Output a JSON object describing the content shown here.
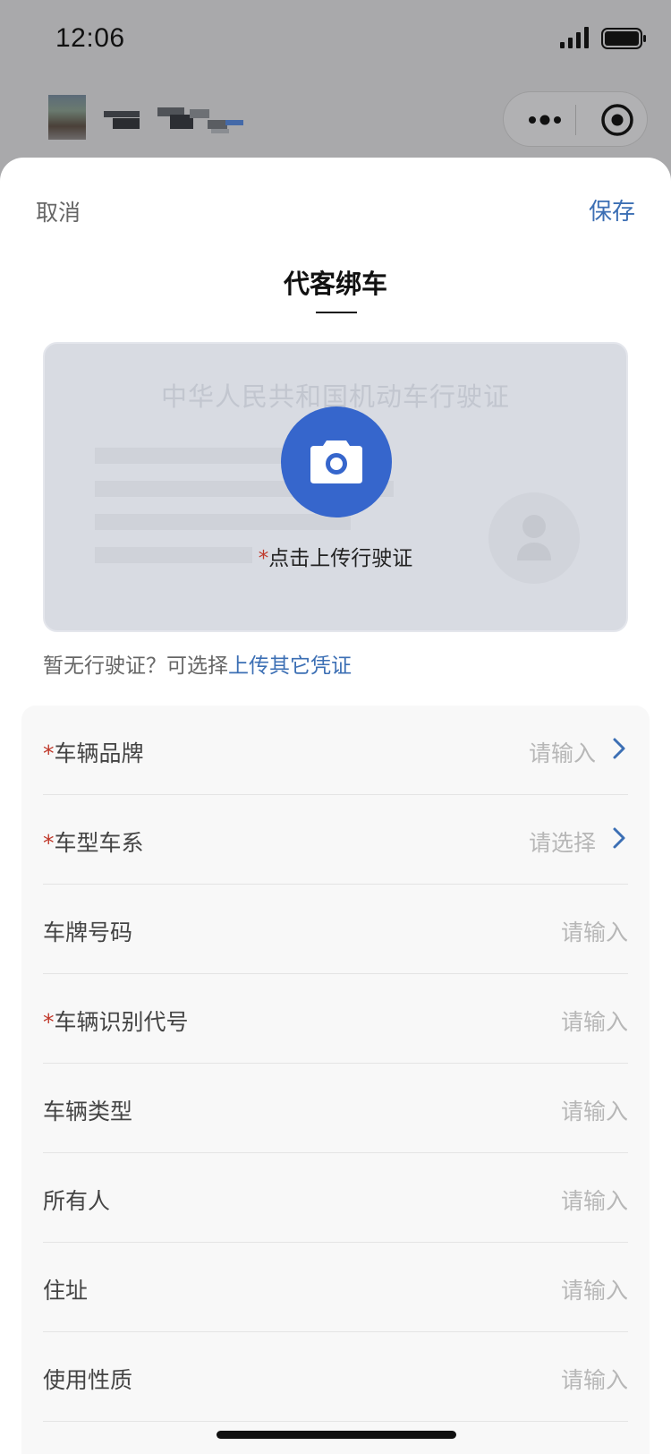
{
  "status_bar": {
    "time": "12:06"
  },
  "header": {
    "more_icon": "more-dots-icon",
    "record_icon": "record-target-icon"
  },
  "sheet": {
    "cancel_label": "取消",
    "save_label": "保存",
    "title": "代客绑车"
  },
  "license_card": {
    "heading": "中华人民共和国机动车行驶证",
    "upload_required_mark": "*",
    "upload_hint": "点击上传行驶证",
    "camera_icon": "camera-icon"
  },
  "alternative": {
    "prefix": "暂无行驶证？可选择",
    "link": "上传其它凭证"
  },
  "form": {
    "rows": [
      {
        "required": "*",
        "label": "车辆品牌",
        "value": "请输入",
        "arrow": true
      },
      {
        "required": "*",
        "label": "车型车系",
        "value": "请选择",
        "arrow": true
      },
      {
        "required": "",
        "label": "车牌号码",
        "value": "请输入",
        "arrow": false
      },
      {
        "required": "*",
        "label": "车辆识别代号",
        "value": "请输入",
        "arrow": false
      },
      {
        "required": "",
        "label": "车辆类型",
        "value": "请输入",
        "arrow": false
      },
      {
        "required": "",
        "label": "所有人",
        "value": "请输入",
        "arrow": false
      },
      {
        "required": "",
        "label": "住址",
        "value": "请输入",
        "arrow": false
      },
      {
        "required": "",
        "label": "使用性质",
        "value": "请输入",
        "arrow": false
      }
    ]
  },
  "colors": {
    "accent": "#3c6fb4",
    "camera_button": "#3666cc",
    "required": "#c0392b",
    "overlay": "#a9a9ab"
  }
}
